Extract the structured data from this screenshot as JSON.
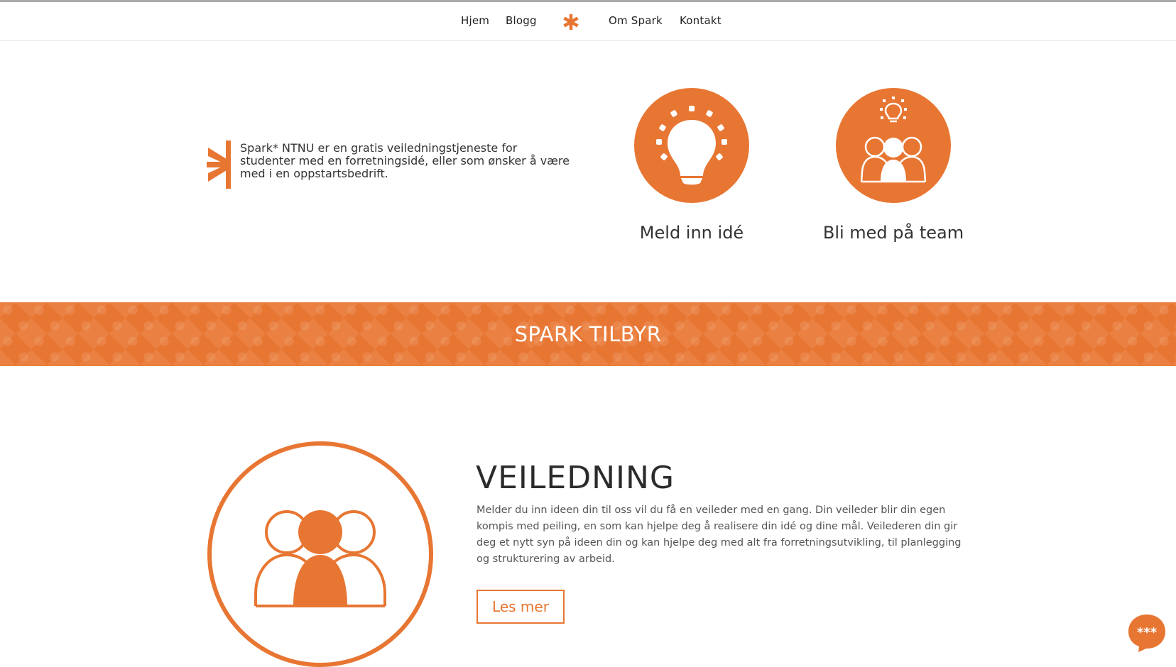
{
  "nav": {
    "items": [
      "Hjem",
      "Blogg",
      "Om Spark",
      "Kontakt"
    ],
    "logo_icon": "asterisk-icon"
  },
  "intro": {
    "text": "Spark* NTNU er en gratis veiledningstjeneste for studenter med en forretningsidé, eller som ønsker å være med i en oppstartsbedrift."
  },
  "actions": [
    {
      "label": "Meld inn idé",
      "icon": "lightbulb-icon"
    },
    {
      "label": "Bli med på team",
      "icon": "team-icon"
    }
  ],
  "band": {
    "title": "SPARK TILBYR"
  },
  "offer": {
    "title": "VEILEDNING",
    "text": "Melder du inn ideen din til oss vil du få en veileder med en gang. Din veileder blir din egen kompis med peiling, en som kan hjelpe deg å realisere din idé og dine mål. Veilederen din gir deg et nytt syn på ideen din og kan hjelpe deg med alt fra forretningsutvikling, til planlegging og strukturering av arbeid.",
    "button_label": "Les mer",
    "icon": "group-icon"
  },
  "chat": {
    "icon": "chat-bubble-icon",
    "glyph": "***"
  },
  "colors": {
    "accent": "#e87633",
    "text": "#333333"
  }
}
